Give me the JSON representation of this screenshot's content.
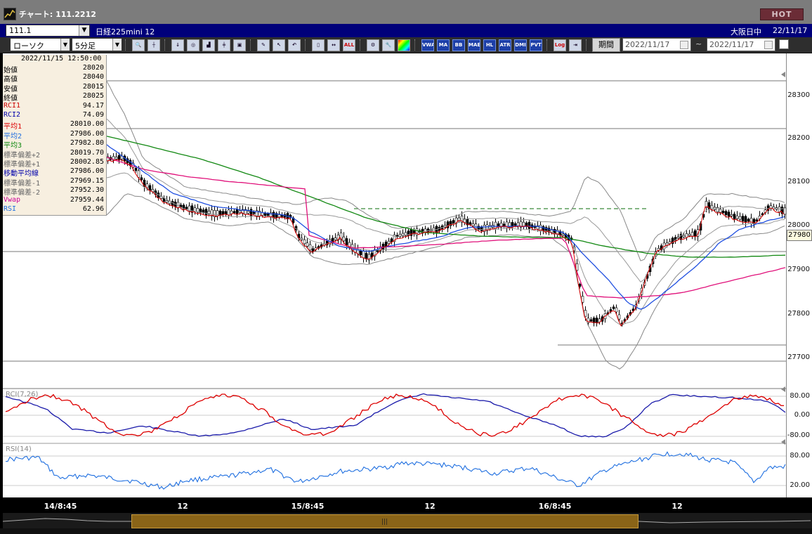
{
  "window": {
    "title": "チャート: 111.2212",
    "hot_label": "HOT"
  },
  "symbar": {
    "code": "111.1",
    "name": "日経225mini 12",
    "market": "大阪日中",
    "date": "22/11/17"
  },
  "toolbar": {
    "chart_type": "ローソク",
    "interval": "5分足",
    "period_label": "期間",
    "date_from": "2022/11/17",
    "date_to": "2022/11/17",
    "tilde": "~",
    "buttons": [
      "ALL",
      "ATR",
      "VWAP",
      "MA",
      "BB",
      "MAE",
      "HL",
      "ATR",
      "DMI",
      "PVT",
      "Log"
    ]
  },
  "info_panel": {
    "datetime": "2022/11/15 12:50:00",
    "rows": [
      {
        "label": "始値",
        "value": "28020",
        "color": "#000000"
      },
      {
        "label": "高値",
        "value": "28040",
        "color": "#000000"
      },
      {
        "label": "安値",
        "value": "28015",
        "color": "#000000"
      },
      {
        "label": "終値",
        "value": "28025",
        "color": "#000000"
      },
      {
        "label": "RCI1",
        "value": "94.17",
        "color": "#cc0000"
      },
      {
        "label": "RCI2",
        "value": "74.09",
        "color": "#0000aa"
      },
      {
        "label": "平均1",
        "value": "28010.00",
        "color": "#dd0000"
      },
      {
        "label": "平均2",
        "value": "27986.00",
        "color": "#1f6fe0"
      },
      {
        "label": "平均3",
        "value": "27982.80",
        "color": "#118811"
      },
      {
        "label": "標準偏差+2",
        "value": "28019.70",
        "color": "#666666"
      },
      {
        "label": "標準偏差+1",
        "value": "28002.85",
        "color": "#666666"
      },
      {
        "label": "移動平均線",
        "value": "27986.00",
        "color": "#0000aa"
      },
      {
        "label": "標準偏差-1",
        "value": "27969.15",
        "color": "#666666"
      },
      {
        "label": "標準偏差-2",
        "value": "27952.30",
        "color": "#666666"
      },
      {
        "label": "Vwap",
        "value": "27959.44",
        "color": "#cc0099"
      },
      {
        "label": "RSI",
        "value": "62.96",
        "color": "#1f6fe0"
      }
    ]
  },
  "price_axis": {
    "labels": [
      "28300",
      "28200",
      "28100",
      "28000",
      "27900",
      "27800",
      "27700"
    ],
    "current": "27980"
  },
  "rci_pane": {
    "label": "RCI(7,26)",
    "levels": [
      "80.00",
      "0.00",
      "-80.00"
    ]
  },
  "rsi_pane": {
    "label": "RSI(14)",
    "levels": [
      "80.00",
      "20.00"
    ]
  },
  "x_axis": {
    "labels": [
      "14/8:45",
      "12",
      "15/8:45",
      "12",
      "16/8:45",
      "12"
    ]
  },
  "colors": {
    "rci_fast": "#dd0000",
    "rci_slow": "#0000aa",
    "ma_fast": "#dd0000",
    "ma_mid": "#1f4fe0",
    "ma_slow": "#118811",
    "vwap": "#e0107a",
    "rsi": "#1f6fe0",
    "band": "#888888"
  }
}
